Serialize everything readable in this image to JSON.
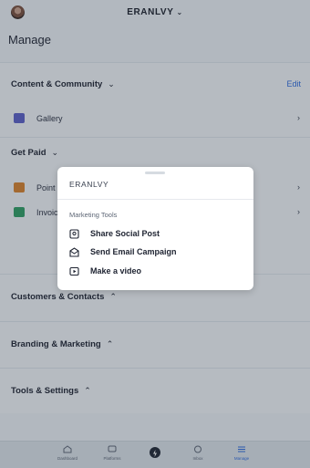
{
  "header": {
    "site_name": "ERANLVY",
    "page_title": "Manage"
  },
  "sections": {
    "content_community": {
      "title": "Content & Community",
      "edit_label": "Edit",
      "gallery_label": "Gallery"
    },
    "get_paid": {
      "title": "Get Paid",
      "row1_label": "Point",
      "row2_label": "Invoic"
    },
    "customers": {
      "title": "Customers & Contacts"
    },
    "branding": {
      "title": "Branding & Marketing"
    },
    "tools": {
      "title": "Tools & Settings"
    }
  },
  "popup": {
    "title": "ERANLVY",
    "subtitle": "Marketing Tools",
    "actions": [
      {
        "label": "Share Social Post",
        "icon": "share-post-icon"
      },
      {
        "label": "Send Email Campaign",
        "icon": "email-campaign-icon"
      },
      {
        "label": "Make a video",
        "icon": "video-icon"
      }
    ]
  },
  "bottom_nav": [
    {
      "label": "Dashboard",
      "icon": "home-icon"
    },
    {
      "label": "Platforms",
      "icon": "chat-icon"
    },
    {
      "label": "",
      "icon": "bolt-icon"
    },
    {
      "label": "Inbox",
      "icon": "inbox-icon"
    },
    {
      "label": "Manage",
      "icon": "menu-icon",
      "active": true
    }
  ],
  "colors": {
    "accent": "#2d6bdd",
    "overlay": "#28323e"
  }
}
